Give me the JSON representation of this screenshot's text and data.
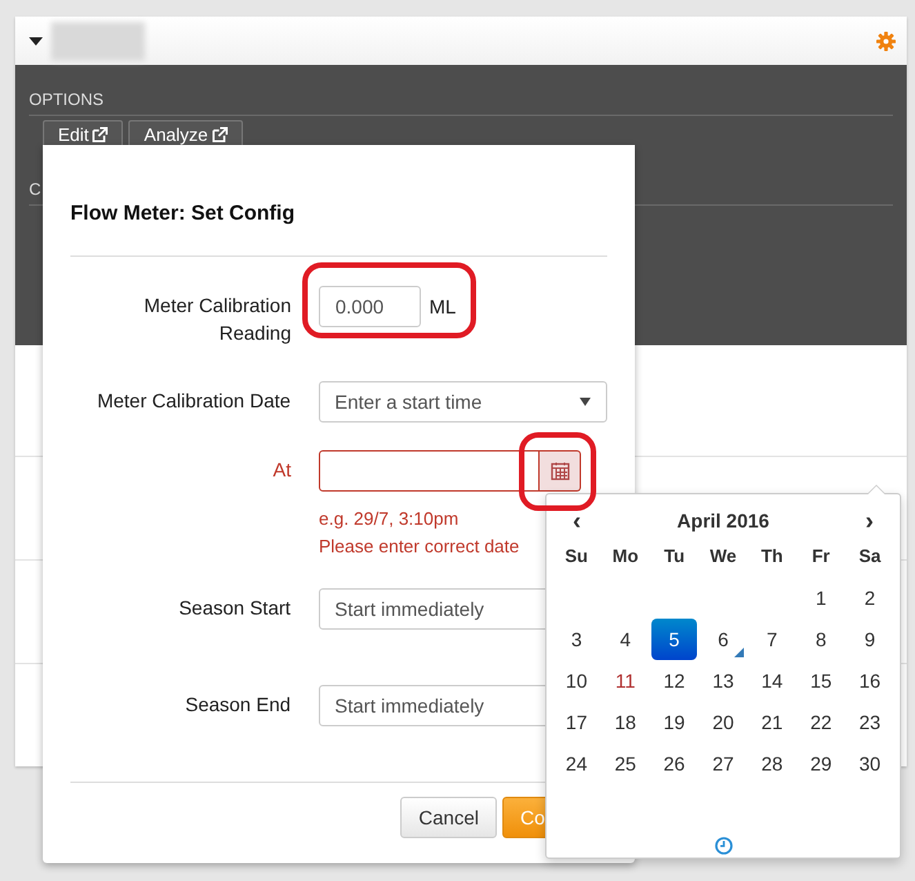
{
  "panel": {
    "options_heading": "OPTIONS",
    "buttons": [
      {
        "label": "Edit"
      },
      {
        "label": "Analyze"
      }
    ],
    "section_heading": "C"
  },
  "dialog": {
    "title": "Flow Meter: Set Config",
    "fields": [
      {
        "kind": "number",
        "label": "Meter Calibration Reading",
        "value": "0.000",
        "unit": "ML"
      },
      {
        "kind": "select",
        "label": "Meter Calibration Date",
        "value": "Enter a start time"
      },
      {
        "kind": "date",
        "label": "At",
        "error": true,
        "help": [
          "e.g. 29/7, 3:10pm",
          "Please enter correct date"
        ]
      },
      {
        "kind": "text",
        "label": "Season Start",
        "value": "Start immediately"
      },
      {
        "kind": "text",
        "label": "Season End",
        "value": "Start immediately"
      }
    ],
    "buttons": [
      {
        "label": "Cancel",
        "kind": "default"
      },
      {
        "label": "Co",
        "kind": "primary"
      }
    ]
  },
  "datepicker": {
    "prev": "‹",
    "month": "April 2016",
    "next": "›",
    "weekdays": [
      "Su",
      "Mo",
      "Tu",
      "We",
      "Th",
      "Fr",
      "Sa"
    ],
    "weeks": [
      [
        {
          "day": "1",
          "selected": false,
          "today": false,
          "marked": false
        },
        {
          "day": "2",
          "selected": false,
          "today": false,
          "marked": false
        }
      ],
      [
        {
          "day": "3",
          "selected": false,
          "today": false,
          "marked": false
        },
        {
          "day": "4",
          "selected": false,
          "today": false,
          "marked": false
        },
        {
          "day": "5",
          "selected": true,
          "today": false,
          "marked": false
        },
        {
          "day": "6",
          "selected": false,
          "today": true,
          "marked": false
        },
        {
          "day": "7",
          "selected": false,
          "today": false,
          "marked": false
        },
        {
          "day": "8",
          "selected": false,
          "today": false,
          "marked": false
        },
        {
          "day": "9",
          "selected": false,
          "today": false,
          "marked": false
        }
      ],
      [
        {
          "day": "10",
          "selected": false,
          "today": false,
          "marked": false
        },
        {
          "day": "11",
          "selected": false,
          "today": false,
          "marked": true
        },
        {
          "day": "12",
          "selected": false,
          "today": false,
          "marked": false
        },
        {
          "day": "13",
          "selected": false,
          "today": false,
          "marked": false
        },
        {
          "day": "14",
          "selected": false,
          "today": false,
          "marked": false
        },
        {
          "day": "15",
          "selected": false,
          "today": false,
          "marked": false
        },
        {
          "day": "16",
          "selected": false,
          "today": false,
          "marked": false
        }
      ],
      [
        {
          "day": "17",
          "selected": false,
          "today": false,
          "marked": false
        },
        {
          "day": "18",
          "selected": false,
          "today": false,
          "marked": false
        },
        {
          "day": "19",
          "selected": false,
          "today": false,
          "marked": false
        },
        {
          "day": "20",
          "selected": false,
          "today": false,
          "marked": false
        },
        {
          "day": "21",
          "selected": false,
          "today": false,
          "marked": false
        },
        {
          "day": "22",
          "selected": false,
          "today": false,
          "marked": false
        },
        {
          "day": "23",
          "selected": false,
          "today": false,
          "marked": false
        }
      ],
      [
        {
          "day": "24",
          "selected": false,
          "today": false,
          "marked": false
        },
        {
          "day": "25",
          "selected": false,
          "today": false,
          "marked": false
        },
        {
          "day": "26",
          "selected": false,
          "today": false,
          "marked": false
        },
        {
          "day": "27",
          "selected": false,
          "today": false,
          "marked": false
        },
        {
          "day": "28",
          "selected": false,
          "today": false,
          "marked": false
        },
        {
          "day": "29",
          "selected": false,
          "today": false,
          "marked": false
        },
        {
          "day": "30",
          "selected": false,
          "today": false,
          "marked": false
        }
      ]
    ]
  }
}
